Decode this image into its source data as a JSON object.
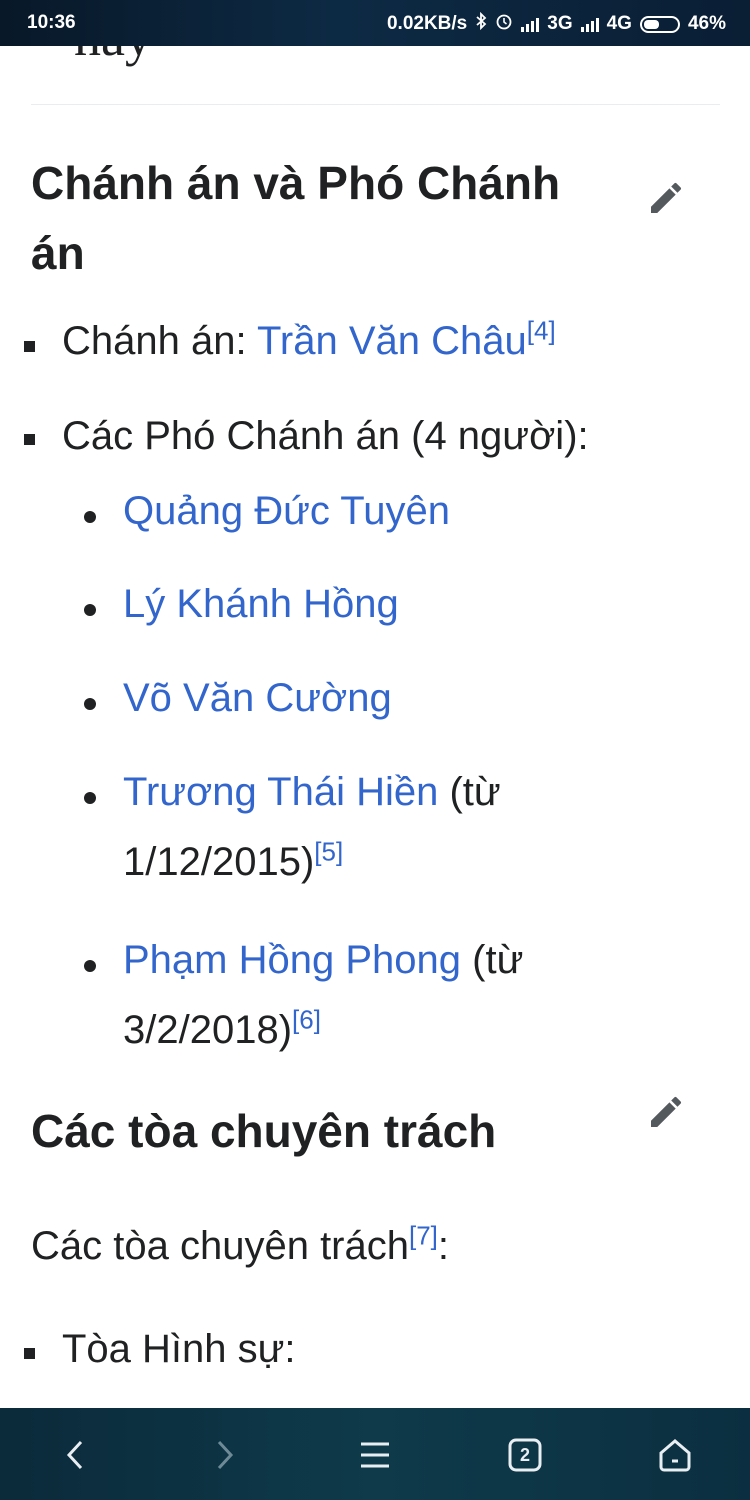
{
  "status_bar": {
    "time": "10:36",
    "speed": "0.02KB/s",
    "net1": "3G",
    "net2": "4G",
    "battery": "46%"
  },
  "article": {
    "cut_heading": "nay",
    "section1": {
      "title": "Chánh án và Phó Chánh án",
      "chief_label": "Chánh án: ",
      "chief_name": "Trần Văn Châu",
      "chief_ref": "[4]",
      "deputies_label": "Các Phó Chánh án (4 người):",
      "deputies": [
        {
          "name": "Quảng Đức Tuyên",
          "note": "",
          "ref": ""
        },
        {
          "name": "Lý Khánh Hồng",
          "note": "",
          "ref": ""
        },
        {
          "name": "Võ Văn Cường",
          "note": "",
          "ref": ""
        },
        {
          "name": "Trương Thái Hiền",
          "note_a": " (từ",
          "note_b": "1/12/2015)",
          "ref": "[5]"
        },
        {
          "name": "Phạm Hồng Phong",
          "note_a": " (từ",
          "note_b": "3/2/2018)",
          "ref": "[6]"
        }
      ]
    },
    "section2": {
      "title": "Các tòa chuyên trách",
      "intro": "Các tòa chuyên trách",
      "intro_ref": "[7]",
      "intro_suffix": ":",
      "first_item": "Tòa Hình sự:"
    }
  },
  "bottom_nav": {
    "tabs_count": "2"
  },
  "colors": {
    "link": "#3366cc",
    "text": "#202122",
    "bar": "#0e3a4a"
  }
}
